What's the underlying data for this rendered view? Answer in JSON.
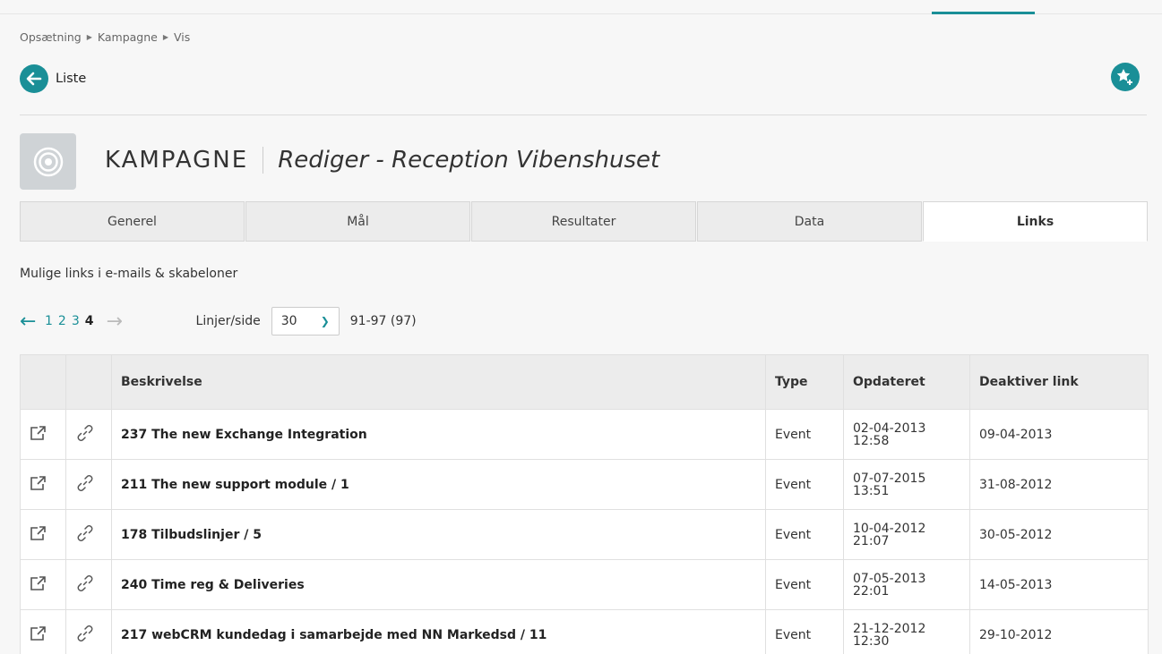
{
  "breadcrumb": [
    "Opsætning",
    "Kampagne",
    "Vis"
  ],
  "back_label": "Liste",
  "entity": {
    "type_label": "KAMPAGNE",
    "subtitle": "Rediger - Reception Vibenshuset"
  },
  "tabs": [
    {
      "label": "Generel",
      "active": false
    },
    {
      "label": "Mål",
      "active": false
    },
    {
      "label": "Resultater",
      "active": false
    },
    {
      "label": "Data",
      "active": false
    },
    {
      "label": "Links",
      "active": true
    }
  ],
  "links_description": "Mulige links i e-mails & skabeloner",
  "pager": {
    "pages": [
      "1",
      "2",
      "3",
      "4"
    ],
    "current": "4",
    "lines_label": "Linjer/side",
    "lines_value": "30",
    "range": "91-97 (97)"
  },
  "table": {
    "headers": [
      "",
      "",
      "Beskrivelse",
      "Type",
      "Opdateret",
      "Deaktiver link"
    ],
    "rows": [
      {
        "desc": "237 The new Exchange Integration",
        "type": "Event",
        "updated_date": "02-04-2013",
        "updated_time": "12:58",
        "deactivate": "09-04-2013"
      },
      {
        "desc": "211 The new support module / 1",
        "type": "Event",
        "updated_date": "07-07-2015",
        "updated_time": "13:51",
        "deactivate": "31-08-2012"
      },
      {
        "desc": "178 Tilbudslinjer / 5",
        "type": "Event",
        "updated_date": "10-04-2012",
        "updated_time": "21:07",
        "deactivate": "30-05-2012"
      },
      {
        "desc": "240 Time reg & Deliveries",
        "type": "Event",
        "updated_date": "07-05-2013",
        "updated_time": "22:01",
        "deactivate": "14-05-2013"
      },
      {
        "desc": "217 webCRM kundedag i samarbejde med NN Markedsd / 11",
        "type": "Event",
        "updated_date": "21-12-2012",
        "updated_time": "12:30",
        "deactivate": "29-10-2012"
      }
    ]
  },
  "colors": {
    "accent": "#1a8f97",
    "entity_icon_bg": "#cfd3d6"
  },
  "icons": {
    "back": "arrow-left-icon",
    "favorite": "star-plus-icon",
    "entity": "target-icon",
    "open": "external-link-icon",
    "link": "chain-link-icon"
  }
}
